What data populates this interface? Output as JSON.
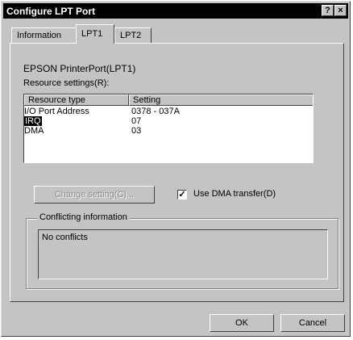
{
  "window": {
    "title": "Configure LPT Port",
    "help_btn": "?",
    "close_btn": "×"
  },
  "tabs": [
    {
      "label": "Information"
    },
    {
      "label": "LPT1"
    },
    {
      "label": "LPT2"
    }
  ],
  "device_name": "EPSON PrinterPort(LPT1)",
  "resource_settings_label": "Resource settings(R):",
  "table": {
    "headers": [
      "Resource type",
      "Setting"
    ],
    "rows": [
      {
        "type": "I/O Port Address",
        "setting": "0378 - 037A"
      },
      {
        "type": "IRQ",
        "setting": "07"
      },
      {
        "type": "DMA",
        "setting": "03"
      }
    ]
  },
  "change_setting_btn": "Change setting(C)...",
  "use_dma": {
    "label": "Use DMA transfer(D)",
    "checked": true,
    "check_mark": "✓"
  },
  "conflicting": {
    "label": "Conflicting information",
    "text": "No conflicts"
  },
  "buttons": {
    "ok": "OK",
    "cancel": "Cancel"
  }
}
